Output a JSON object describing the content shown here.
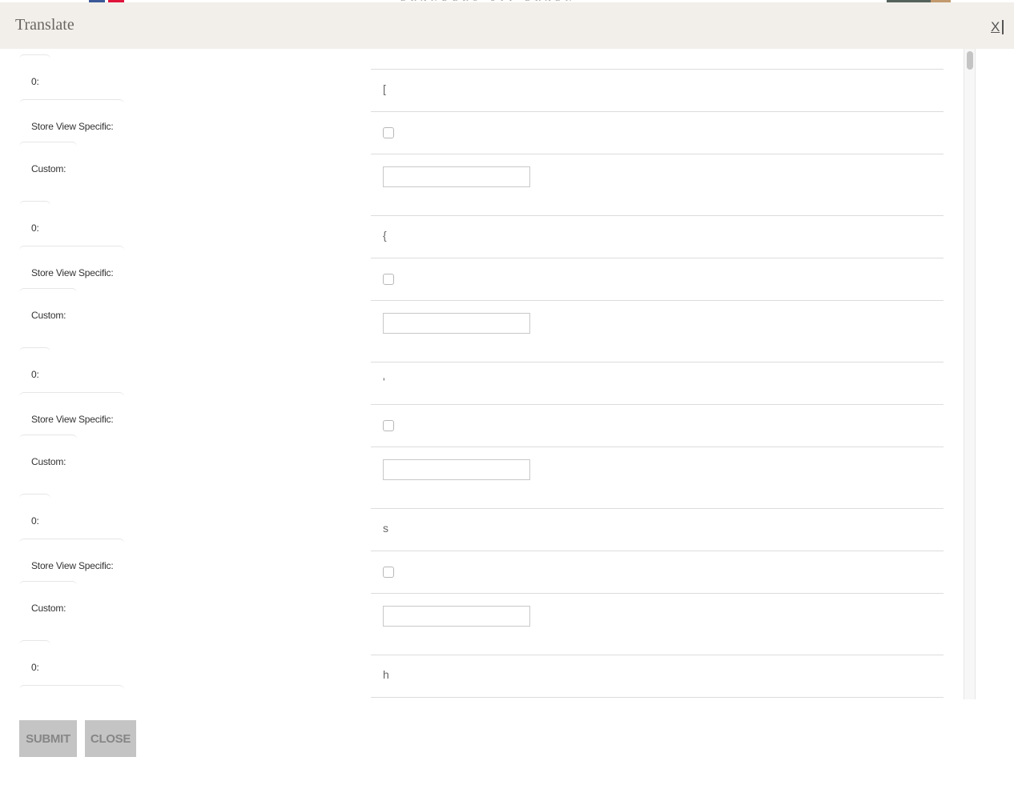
{
  "modal": {
    "title": "Translate",
    "close_label": "X"
  },
  "background_page": {
    "brand_text": "BRANDERS UIT BRABN"
  },
  "fields": {
    "key_label": "0:",
    "store_view_label": "Store View Specific:",
    "custom_label": "Custom:"
  },
  "entries": [
    {
      "original": "[",
      "store_view_specific": false,
      "custom_value": ""
    },
    {
      "original": "{",
      "store_view_specific": false,
      "custom_value": ""
    },
    {
      "original": "'",
      "store_view_specific": false,
      "custom_value": ""
    },
    {
      "original": "s",
      "store_view_specific": false,
      "custom_value": ""
    },
    {
      "original": "h",
      "store_view_specific": false,
      "custom_value": ""
    }
  ],
  "buttons": {
    "submit": "SUBMIT",
    "close": "CLOSE"
  },
  "colors": {
    "header_bg": "#f2efea",
    "button_bg": "#c4c4c4",
    "button_text": "#868686"
  }
}
